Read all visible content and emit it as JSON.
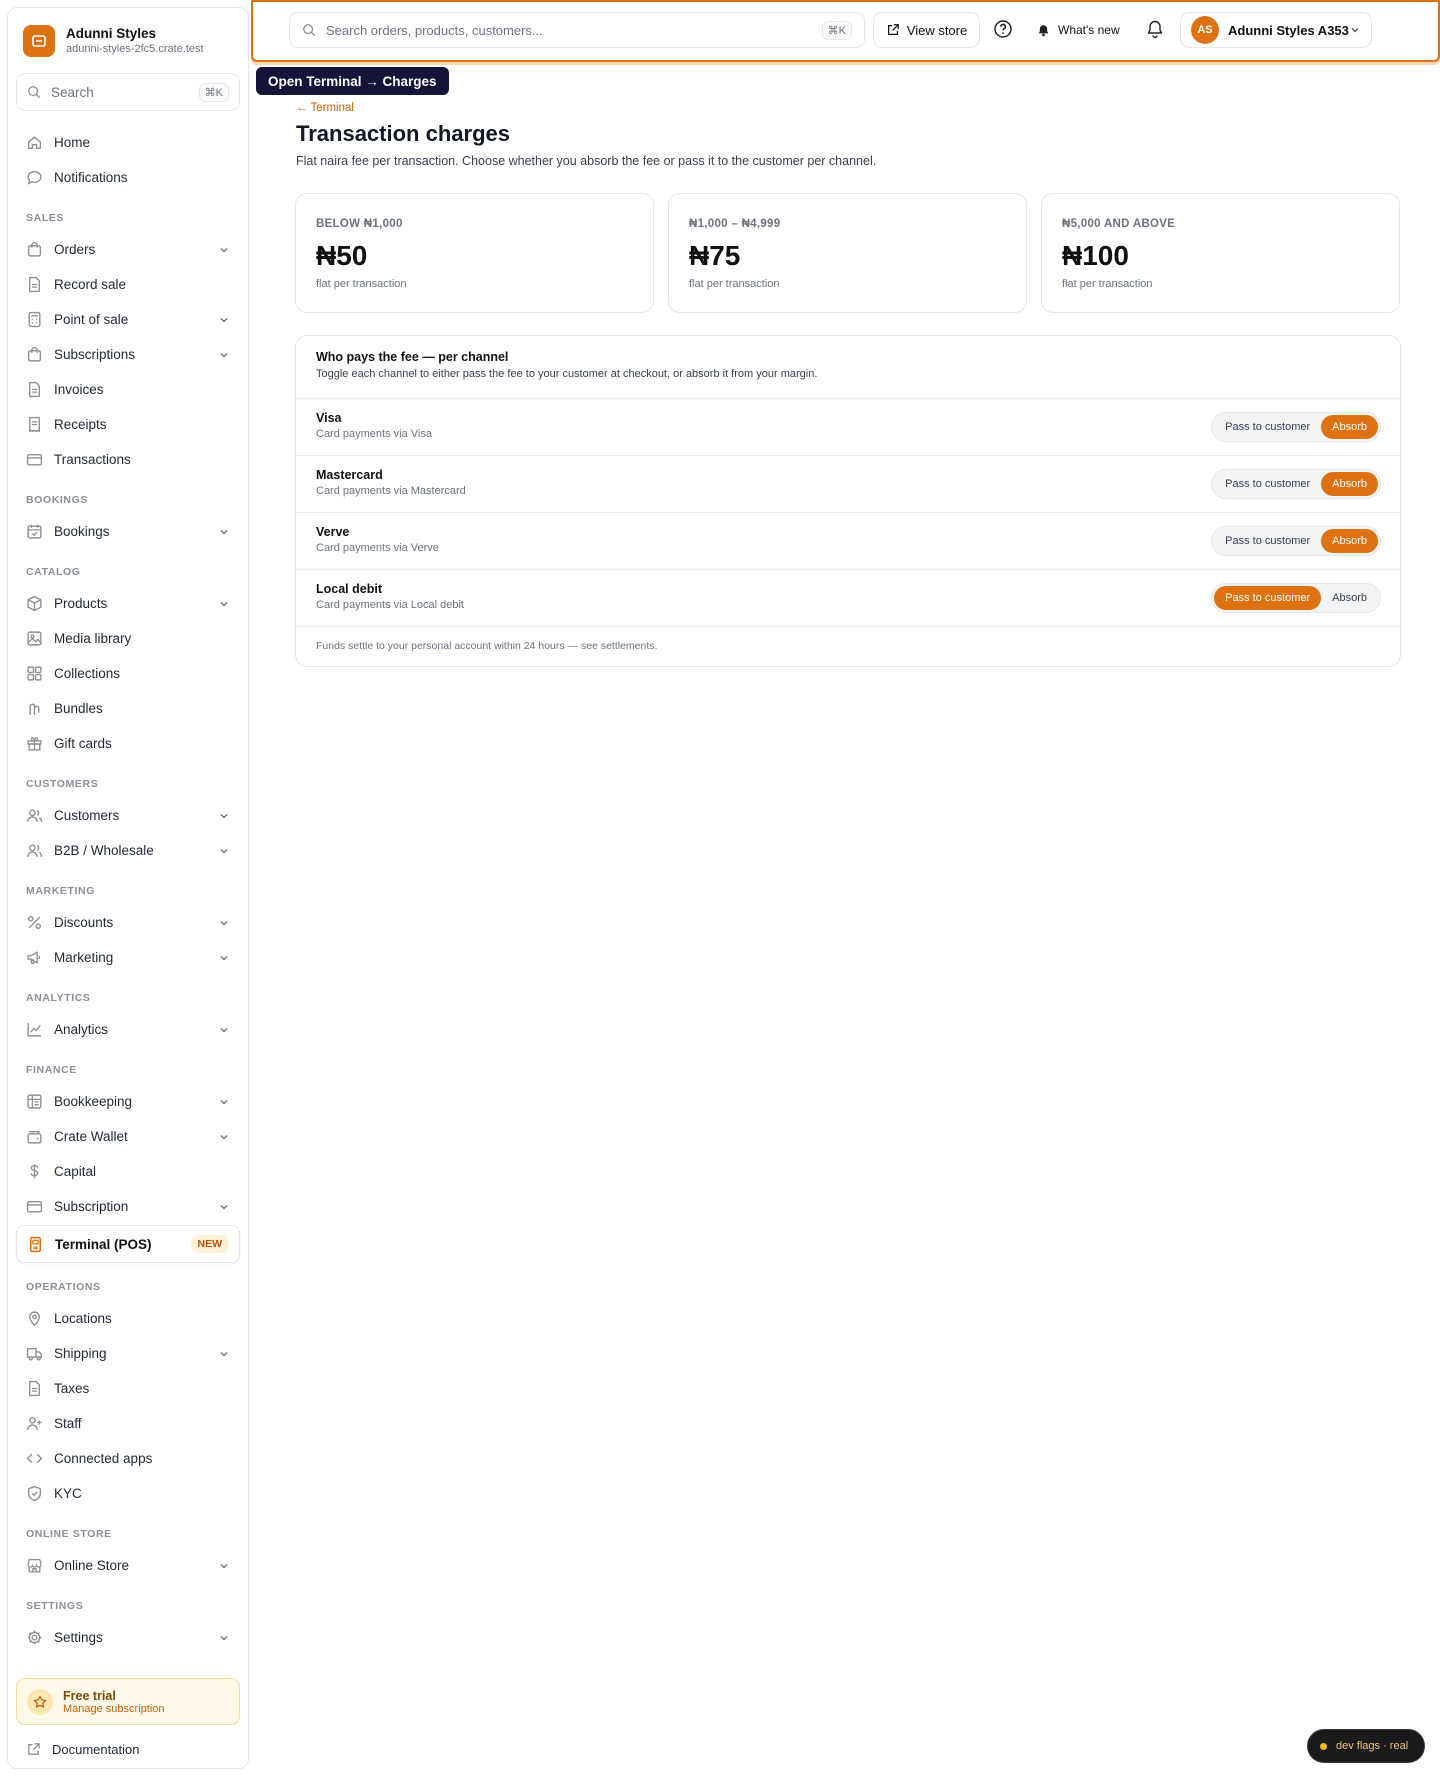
{
  "brand": {
    "name": "Adunni Styles",
    "domain": "adunni-styles-2fc5.crate.test"
  },
  "sidebar": {
    "search": {
      "placeholder": "Search",
      "shortcut": "⌘K"
    },
    "items": [
      {
        "type": "item",
        "label": "Home",
        "icon": "home-icon"
      },
      {
        "type": "item",
        "label": "Notifications",
        "icon": "chat-bubble-icon"
      },
      {
        "type": "section",
        "label": "SALES"
      },
      {
        "type": "item",
        "label": "Orders",
        "icon": "bag-icon",
        "expandable": true
      },
      {
        "type": "item",
        "label": "Record sale",
        "icon": "document-icon"
      },
      {
        "type": "item",
        "label": "Point of sale",
        "icon": "calculator-icon",
        "expandable": true
      },
      {
        "type": "item",
        "label": "Subscriptions",
        "icon": "bag-icon",
        "expandable": true
      },
      {
        "type": "item",
        "label": "Invoices",
        "icon": "document-icon"
      },
      {
        "type": "item",
        "label": "Receipts",
        "icon": "receipt-icon"
      },
      {
        "type": "item",
        "label": "Transactions",
        "icon": "card-icon"
      },
      {
        "type": "section",
        "label": "BOOKINGS"
      },
      {
        "type": "item",
        "label": "Bookings",
        "icon": "calendar-icon",
        "expandable": true
      },
      {
        "type": "section",
        "label": "CATALOG"
      },
      {
        "type": "item",
        "label": "Products",
        "icon": "box-icon",
        "expandable": true
      },
      {
        "type": "item",
        "label": "Media library",
        "icon": "image-icon"
      },
      {
        "type": "item",
        "label": "Collections",
        "icon": "grid-icon"
      },
      {
        "type": "item",
        "label": "Bundles",
        "icon": "bundle-icon"
      },
      {
        "type": "item",
        "label": "Gift cards",
        "icon": "gift-icon"
      },
      {
        "type": "section",
        "label": "CUSTOMERS"
      },
      {
        "type": "item",
        "label": "Customers",
        "icon": "users-icon",
        "expandable": true
      },
      {
        "type": "item",
        "label": "B2B / Wholesale",
        "icon": "users-icon",
        "expandable": true
      },
      {
        "type": "section",
        "label": "MARKETING"
      },
      {
        "type": "item",
        "label": "Discounts",
        "icon": "discount-icon",
        "expandable": true
      },
      {
        "type": "item",
        "label": "Marketing",
        "icon": "megaphone-icon",
        "expandable": true
      },
      {
        "type": "section",
        "label": "ANALYTICS"
      },
      {
        "type": "item",
        "label": "Analytics",
        "icon": "line-chart-icon",
        "expandable": true
      },
      {
        "type": "section",
        "label": "FINANCE"
      },
      {
        "type": "item",
        "label": "Bookkeeping",
        "icon": "ledger-icon",
        "expandable": true
      },
      {
        "type": "item",
        "label": "Crate Wallet",
        "icon": "wallet-icon",
        "expandable": true
      },
      {
        "type": "item",
        "label": "Capital",
        "icon": "dollar-icon"
      },
      {
        "type": "item",
        "label": "Subscription",
        "icon": "card-icon",
        "expandable": true
      },
      {
        "type": "item",
        "label": "Terminal (POS)",
        "icon": "terminal-icon",
        "active": true,
        "badge": "NEW"
      },
      {
        "type": "section",
        "label": "OPERATIONS"
      },
      {
        "type": "item",
        "label": "Locations",
        "icon": "pin-icon"
      },
      {
        "type": "item",
        "label": "Shipping",
        "icon": "truck-icon",
        "expandable": true
      },
      {
        "type": "item",
        "label": "Taxes",
        "icon": "document-icon"
      },
      {
        "type": "item",
        "label": "Staff",
        "icon": "user-plus-icon"
      },
      {
        "type": "item",
        "label": "Connected apps",
        "icon": "code-icon"
      },
      {
        "type": "item",
        "label": "KYC",
        "icon": "shield-icon"
      },
      {
        "type": "section",
        "label": "ONLINE STORE"
      },
      {
        "type": "item",
        "label": "Online Store",
        "icon": "store-icon",
        "expandable": true
      },
      {
        "type": "section",
        "label": "SETTINGS"
      },
      {
        "type": "item",
        "label": "Settings",
        "icon": "gear-icon",
        "expandable": true
      }
    ],
    "trial": {
      "title": "Free trial",
      "subtitle": "Manage subscription"
    },
    "docs": {
      "label": "Documentation"
    }
  },
  "topbar": {
    "search_placeholder": "Search orders, products, customers...",
    "search_shortcut": "⌘K",
    "view_store": "View store",
    "whats_new": "What's new",
    "account": {
      "initials": "AS",
      "name": "Adunni Styles A353"
    }
  },
  "tooltip": "Open Terminal → Charges",
  "page": {
    "back": "← Terminal",
    "title": "Transaction charges",
    "subtitle": "Flat naira fee per transaction. Choose whether you absorb the fee or pass it to the customer per channel."
  },
  "tiers": [
    {
      "range": "BELOW ₦1,000",
      "amount": "₦50",
      "unit": "flat per transaction"
    },
    {
      "range": "₦1,000 – ₦4,999",
      "amount": "₦75",
      "unit": "flat per transaction"
    },
    {
      "range": "₦5,000 AND ABOVE",
      "amount": "₦100",
      "unit": "flat per transaction"
    }
  ],
  "fees": {
    "title": "Who pays the fee — per channel",
    "description": "Toggle each channel to either pass the fee to your customer at checkout, or absorb it from your margin.",
    "options": {
      "pass": "Pass to customer",
      "absorb": "Absorb"
    },
    "channels": [
      {
        "name": "Visa",
        "desc": "Card payments via Visa",
        "selected": "absorb"
      },
      {
        "name": "Mastercard",
        "desc": "Card payments via Mastercard",
        "selected": "absorb"
      },
      {
        "name": "Verve",
        "desc": "Card payments via Verve",
        "selected": "absorb"
      },
      {
        "name": "Local debit",
        "desc": "Card payments via Local debit",
        "selected": "pass"
      }
    ],
    "footer": "Funds settle to your personal account within 24 hours — see settlements."
  },
  "devflags": "dev flags · real",
  "colors": {
    "accent": "#de7212",
    "tooltip_bg": "#16133a"
  }
}
